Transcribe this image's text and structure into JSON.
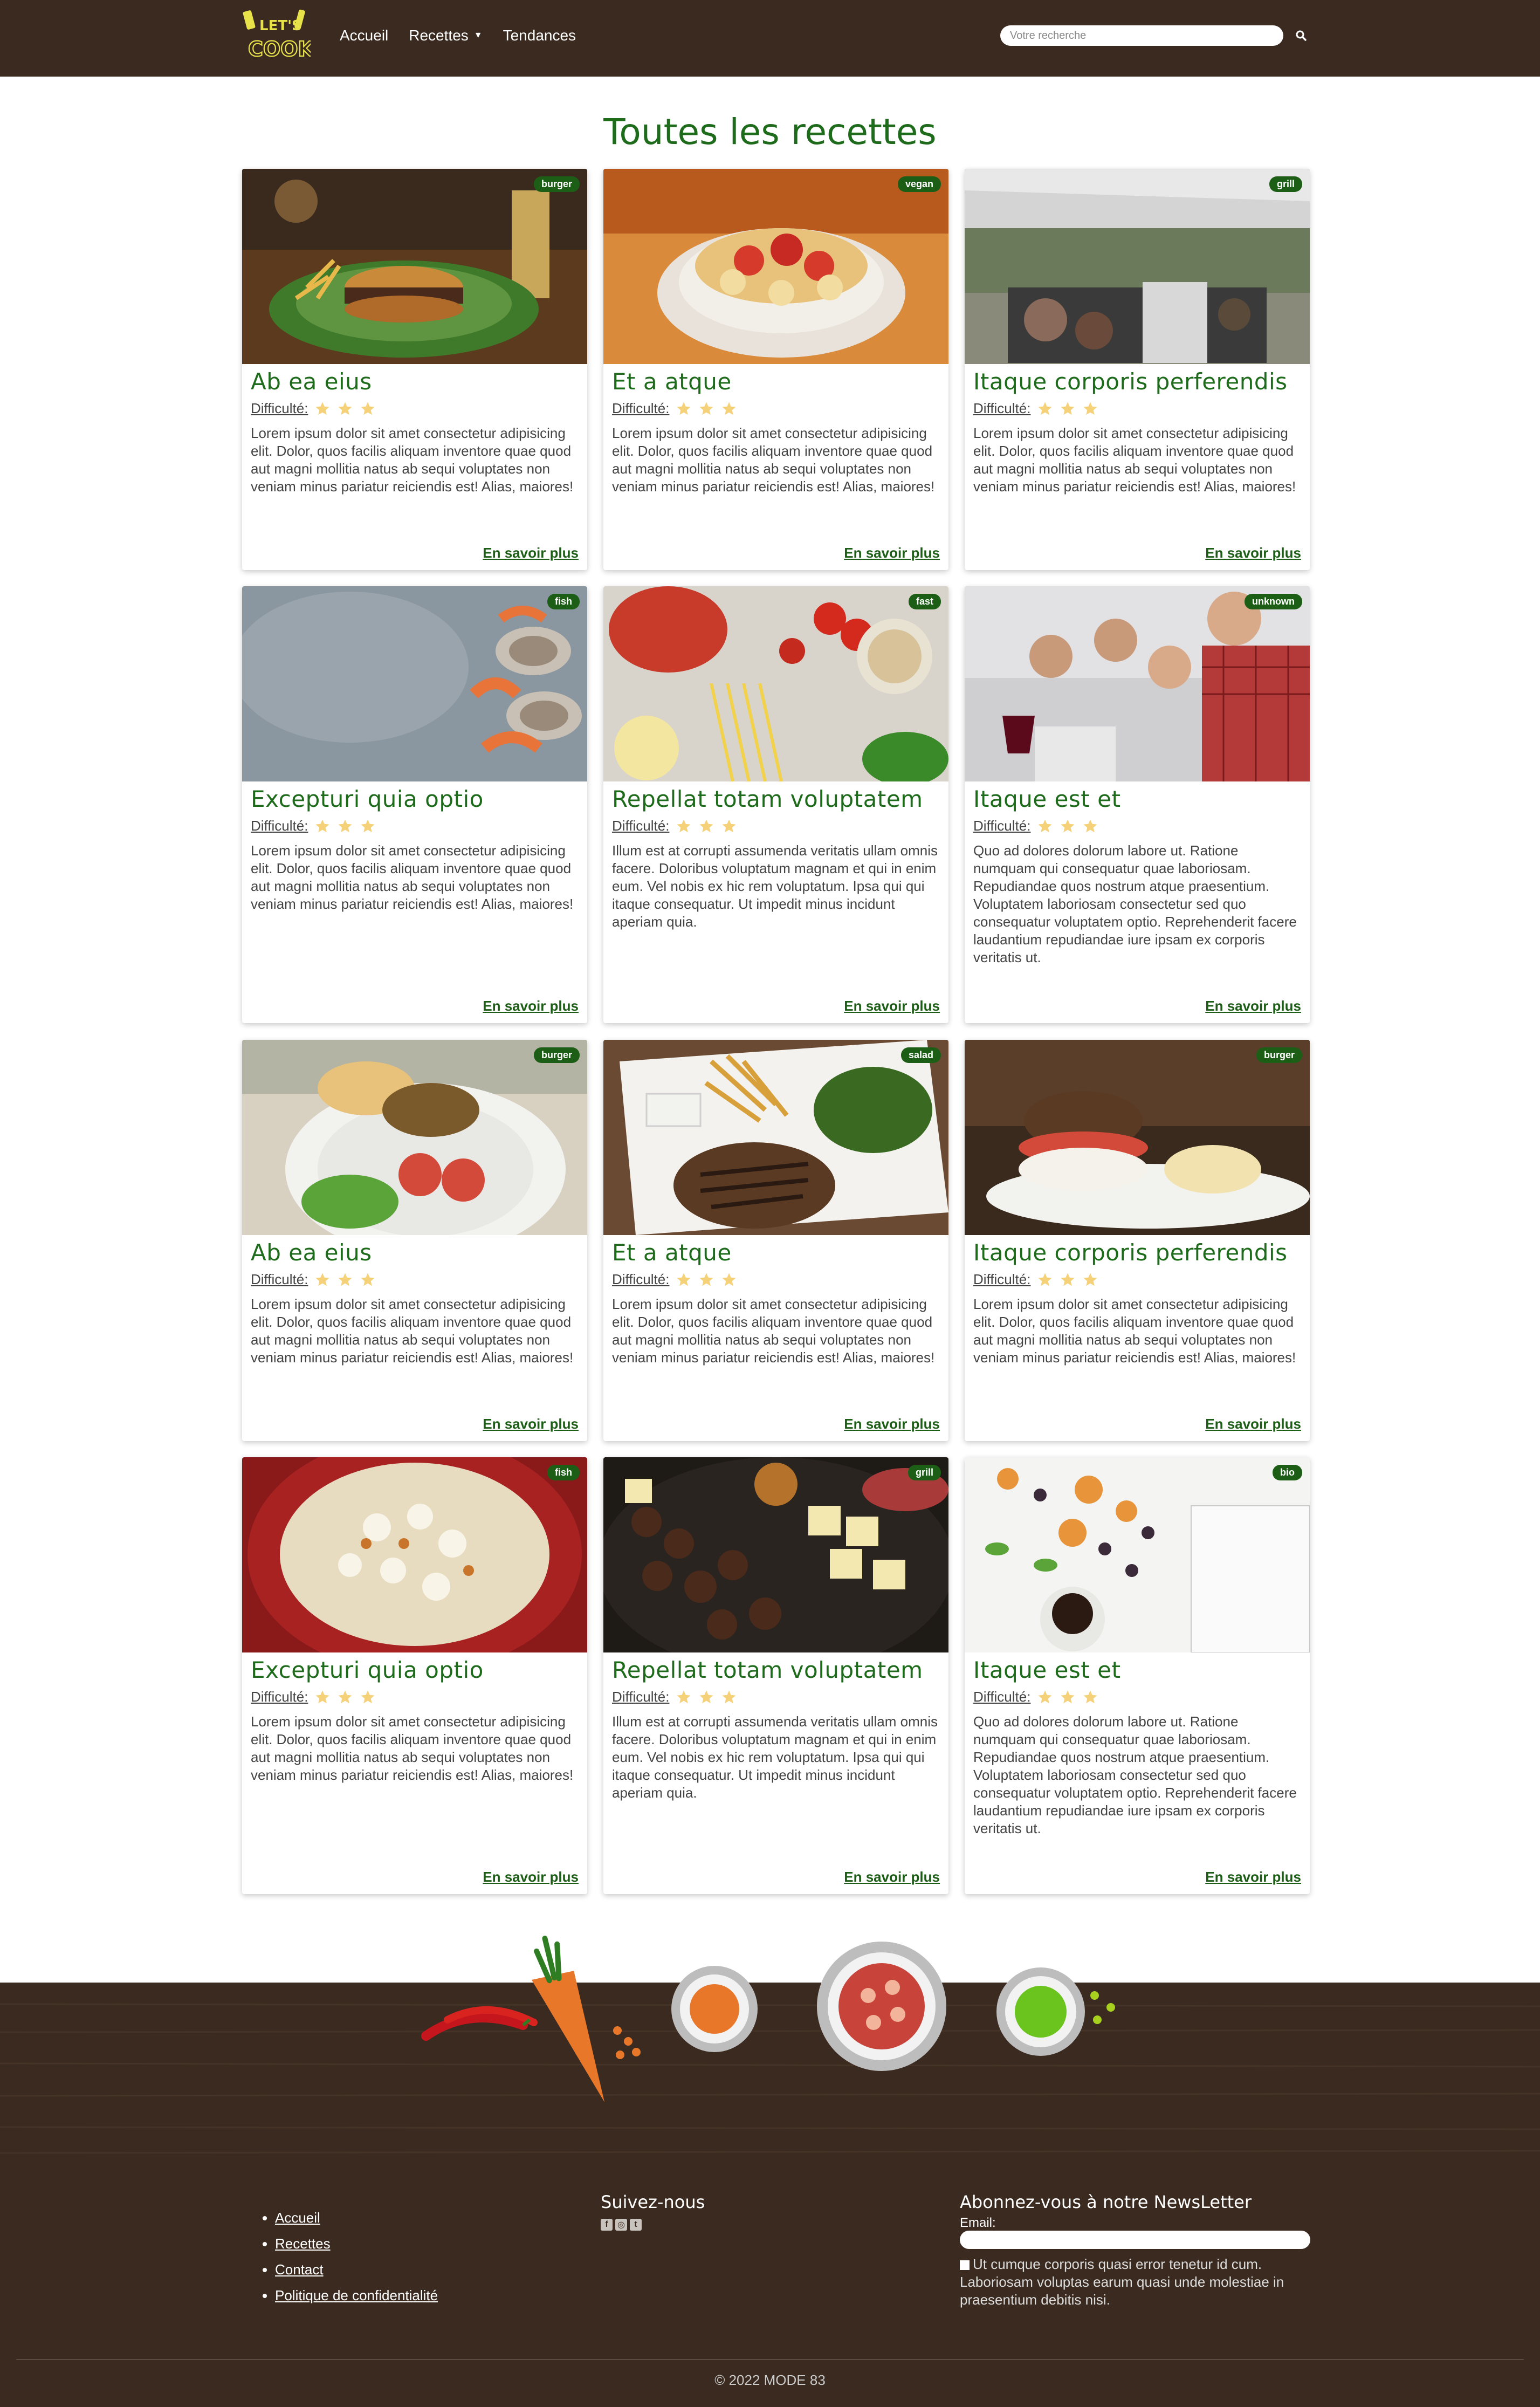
{
  "nav": {
    "logo_text_top": "LET'S",
    "logo_text_bottom": "COOK",
    "links": [
      {
        "label": "Accueil"
      },
      {
        "label": "Recettes",
        "has_dropdown": true
      },
      {
        "label": "Tendances"
      }
    ],
    "search_placeholder": "Votre recherche"
  },
  "page_title": "Toutes les recettes",
  "recipe_link_label": "En savoir plus",
  "difficulty_label": "Difficulté:",
  "recipes": [
    {
      "title": "Ab ea eius",
      "badge": "burger",
      "stars": 3,
      "text": "Lorem ipsum dolor sit amet consectetur adipisicing elit. Dolor, quos facilis aliquam inventore quae quod aut magni mollitia natus ab sequi voluptates non veniam minus pariatur reiciendis est! Alias, maiores!"
    },
    {
      "title": "Et a atque",
      "badge": "vegan",
      "stars": 3,
      "text": "Lorem ipsum dolor sit amet consectetur adipisicing elit. Dolor, quos facilis aliquam inventore quae quod aut magni mollitia natus ab sequi voluptates non veniam minus pariatur reiciendis est! Alias, maiores!"
    },
    {
      "title": "Itaque corporis perferendis",
      "badge": "grill",
      "stars": 3,
      "text": "Lorem ipsum dolor sit amet consectetur adipisicing elit. Dolor, quos facilis aliquam inventore quae quod aut magni mollitia natus ab sequi voluptates non veniam minus pariatur reiciendis est! Alias, maiores!"
    },
    {
      "title": "Excepturi quia optio",
      "badge": "fish",
      "stars": 3,
      "text": "Lorem ipsum dolor sit amet consectetur adipisicing elit. Dolor, quos facilis aliquam inventore quae quod aut magni mollitia natus ab sequi voluptates non veniam minus pariatur reiciendis est! Alias, maiores!"
    },
    {
      "title": "Repellat totam voluptatem",
      "badge": "fast",
      "stars": 3,
      "text": "Illum est at corrupti assumenda veritatis ullam omnis facere. Doloribus voluptatum magnam et qui in enim eum. Vel nobis ex hic rem voluptatum. Ipsa qui qui itaque consequatur. Ut impedit minus incidunt aperiam quia."
    },
    {
      "title": "Itaque est et",
      "badge": "unknown",
      "stars": 3,
      "text": "Quo ad dolores dolorum labore ut. Ratione numquam qui consequatur quae laboriosam. Repudiandae quos nostrum atque praesentium. Voluptatem laboriosam consectetur sed quo consequatur voluptatem optio. Reprehenderit facere laudantium repudiandae iure ipsam ex corporis veritatis ut."
    },
    {
      "title": "Ab ea eius",
      "badge": "burger",
      "stars": 3,
      "text": "Lorem ipsum dolor sit amet consectetur adipisicing elit. Dolor, quos facilis aliquam inventore quae quod aut magni mollitia natus ab sequi voluptates non veniam minus pariatur reiciendis est! Alias, maiores!"
    },
    {
      "title": "Et a atque",
      "badge": "salad",
      "stars": 3,
      "text": "Lorem ipsum dolor sit amet consectetur adipisicing elit. Dolor, quos facilis aliquam inventore quae quod aut magni mollitia natus ab sequi voluptates non veniam minus pariatur reiciendis est! Alias, maiores!"
    },
    {
      "title": "Itaque corporis perferendis",
      "badge": "burger",
      "stars": 3,
      "text": "Lorem ipsum dolor sit amet consectetur adipisicing elit. Dolor, quos facilis aliquam inventore quae quod aut magni mollitia natus ab sequi voluptates non veniam minus pariatur reiciendis est! Alias, maiores!"
    },
    {
      "title": "Excepturi quia optio",
      "badge": "fish",
      "stars": 3,
      "text": "Lorem ipsum dolor sit amet consectetur adipisicing elit. Dolor, quos facilis aliquam inventore quae quod aut magni mollitia natus ab sequi voluptates non veniam minus pariatur reiciendis est! Alias, maiores!"
    },
    {
      "title": "Repellat totam voluptatem",
      "badge": "grill",
      "stars": 3,
      "text": "Illum est at corrupti assumenda veritatis ullam omnis facere. Doloribus voluptatum magnam et qui in enim eum. Vel nobis ex hic rem voluptatum. Ipsa qui qui itaque consequatur. Ut impedit minus incidunt aperiam quia."
    },
    {
      "title": "Itaque est et",
      "badge": "bio",
      "stars": 3,
      "text": "Quo ad dolores dolorum labore ut. Ratione numquam qui consequatur quae laboriosam. Repudiandae quos nostrum atque praesentium. Voluptatem laboriosam consectetur sed quo consequatur voluptatem optio. Reprehenderit facere laudantium repudiandae iure ipsam ex corporis veritatis ut."
    }
  ],
  "footer": {
    "links": [
      "Accueil",
      "Recettes",
      "Contact",
      "Politique de confidentialité"
    ],
    "social_title": "Suivez-nous",
    "social_icons": [
      "facebook-icon",
      "instagram-icon",
      "twitter-icon"
    ],
    "newsletter_title": "Abonnez-vous à notre NewsLetter",
    "email_label": "Email:",
    "consent_text": "Ut cumque corporis quasi error tenetur id cum. Laboriosam voluptas earum quasi unde molestiae in praesentium debitis nisi.",
    "copyright": "© 2022 MODE 83"
  },
  "colors": {
    "brand_brown": "#3a2a1f",
    "title_green": "#1d6b1b",
    "badge_green": "#1d5e17",
    "star_yellow": "#f5d27a"
  }
}
